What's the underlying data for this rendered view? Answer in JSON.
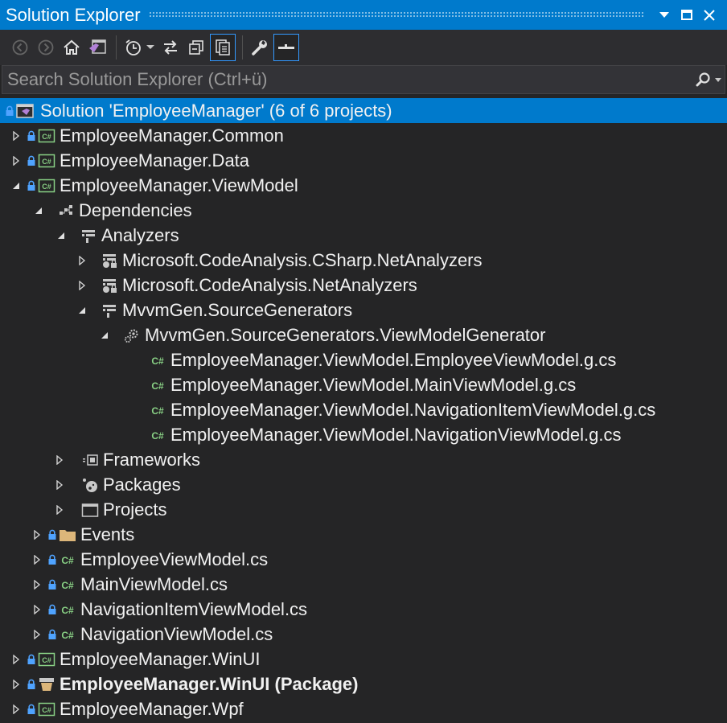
{
  "window": {
    "title": "Solution Explorer",
    "controls": [
      "dropdown",
      "maximize",
      "close"
    ]
  },
  "toolbar": {
    "buttons": [
      {
        "name": "back-button",
        "icon": "arrow-left-icon"
      },
      {
        "name": "forward-button",
        "icon": "arrow-right-icon"
      },
      {
        "name": "home-button",
        "icon": "home-icon"
      },
      {
        "name": "switch-views-button",
        "icon": "visual-studio-icon"
      },
      {
        "name": "pending-changes-filter-button",
        "icon": "clock-icon"
      },
      {
        "name": "sync-active-document-button",
        "icon": "sync-icon"
      },
      {
        "name": "collapse-all-button",
        "icon": "collapse-all-icon"
      },
      {
        "name": "show-all-files-button",
        "icon": "show-all-files-icon",
        "checked": true
      },
      {
        "name": "properties-button",
        "icon": "wrench-icon"
      },
      {
        "name": "preview-selected-items-button",
        "icon": "preview-icon",
        "checked": true
      }
    ]
  },
  "search": {
    "placeholder": "Search Solution Explorer (Ctrl+ü)",
    "value": ""
  },
  "tree": {
    "solution": "Solution 'EmployeeManager' (6 of 6 projects)",
    "project_common": "EmployeeManager.Common",
    "project_data": "EmployeeManager.Data",
    "project_viewmodel": "EmployeeManager.ViewModel",
    "dependencies": "Dependencies",
    "analyzers": "Analyzers",
    "analyzer_csharp": "Microsoft.CodeAnalysis.CSharp.NetAnalyzers",
    "analyzer_net": "Microsoft.CodeAnalysis.NetAnalyzers",
    "source_generators": "MvvmGen.SourceGenerators",
    "viewmodel_generator": "MvvmGen.SourceGenerators.ViewModelGenerator",
    "gen_employee": "EmployeeManager.ViewModel.EmployeeViewModel.g.cs",
    "gen_main": "EmployeeManager.ViewModel.MainViewModel.g.cs",
    "gen_navitem": "EmployeeManager.ViewModel.NavigationItemViewModel.g.cs",
    "gen_nav": "EmployeeManager.ViewModel.NavigationViewModel.g.cs",
    "frameworks": "Frameworks",
    "packages": "Packages",
    "projects": "Projects",
    "events": "Events",
    "file_employee": "EmployeeViewModel.cs",
    "file_main": "MainViewModel.cs",
    "file_navitem": "NavigationItemViewModel.cs",
    "file_nav": "NavigationViewModel.cs",
    "project_winui": "EmployeeManager.WinUI",
    "project_winui_package": "EmployeeManager.WinUI (Package)",
    "project_wpf": "EmployeeManager.Wpf"
  },
  "colors": {
    "accent": "#007acc",
    "background": "#252526",
    "csharp_icon": "#89d185",
    "lock_icon": "#4fa3ff",
    "folder": "#dcb67a"
  }
}
